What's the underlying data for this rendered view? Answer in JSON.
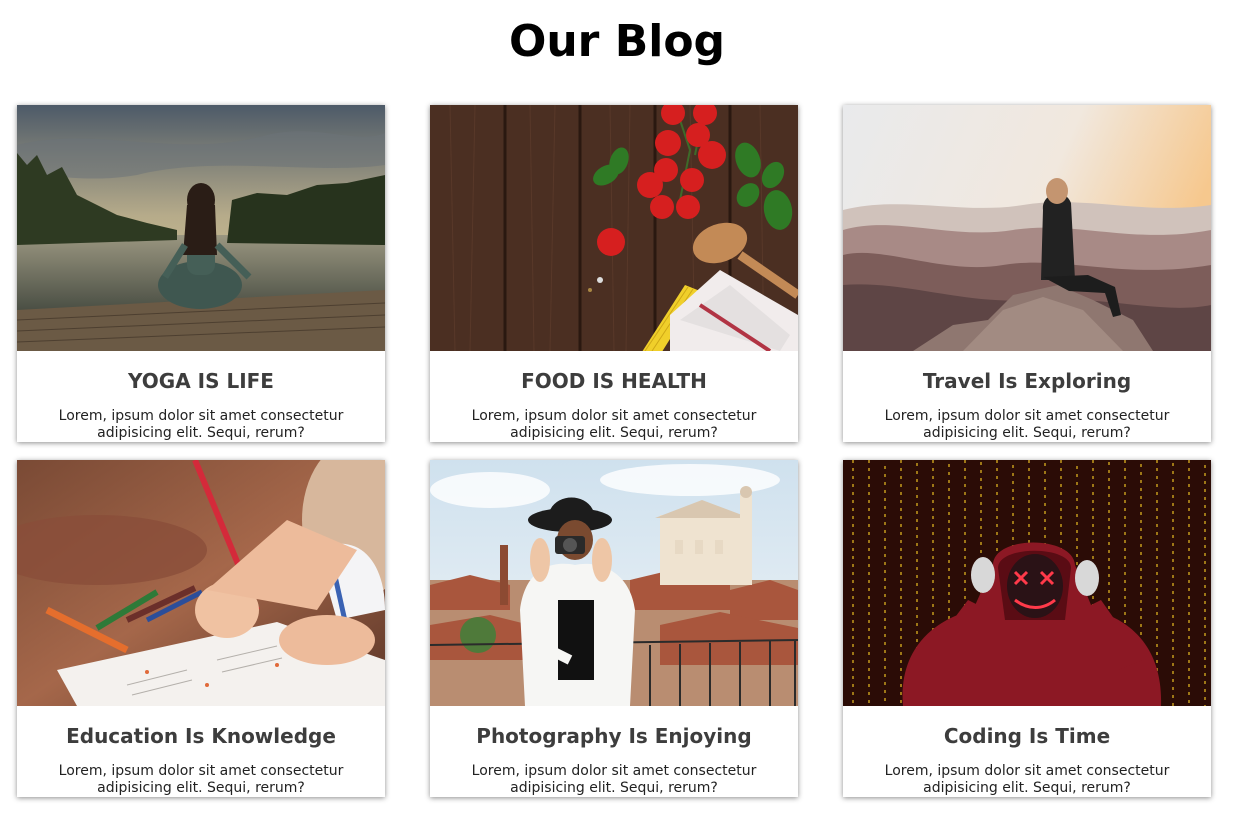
{
  "page": {
    "title": "Our Blog"
  },
  "cards": [
    {
      "image_subject": "woman meditating on a lake dock at sunset",
      "title": "YOGA IS LIFE",
      "text": "Lorem, ipsum dolor sit amet consectetur adipisicing elit. Sequi, rerum?"
    },
    {
      "image_subject": "tomatoes, basil, pasta and wooden spoon on a wooden table",
      "title": "FOOD IS HEALTH",
      "text": "Lorem, ipsum dolor sit amet consectetur adipisicing elit. Sequi, rerum?"
    },
    {
      "image_subject": "woman sitting on a mountain rock at sunrise",
      "title": "Travel Is Exploring",
      "text": "Lorem, ipsum dolor sit amet consectetur adipisicing elit. Sequi, rerum?"
    },
    {
      "image_subject": "child writing with a red pencil, colored pencils on desk",
      "title": "Education Is Knowledge",
      "text": "Lorem, ipsum dolor sit amet consectetur adipisicing elit. Sequi, rerum?"
    },
    {
      "image_subject": "woman in black hat taking a photo over a town of rooftops",
      "title": "Photography Is Enjoying",
      "text": "Lorem, ipsum dolor sit amet consectetur adipisicing elit. Sequi, rerum?"
    },
    {
      "image_subject": "hooded figure with glowing neon mask in front of matrix code",
      "title": "Coding Is Time",
      "text": "Lorem, ipsum dolor sit amet consectetur adipisicing elit. Sequi, rerum?"
    }
  ]
}
